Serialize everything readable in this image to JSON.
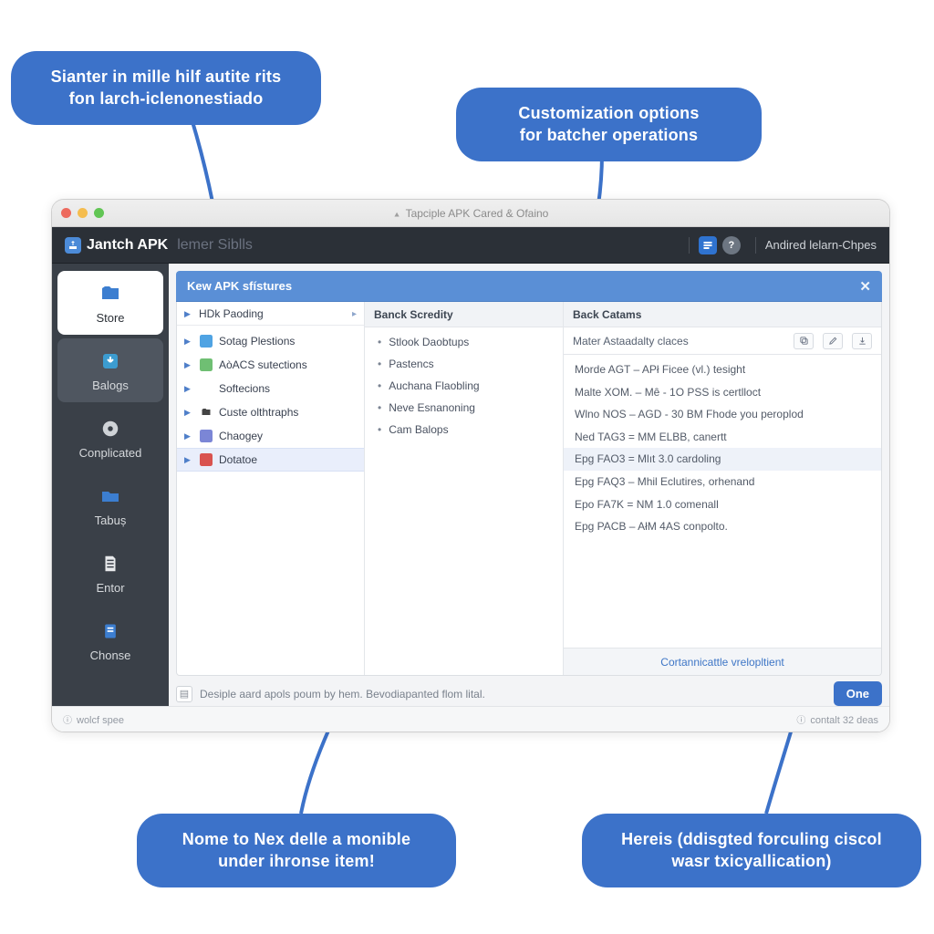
{
  "callouts": {
    "top_left": {
      "line1": "Sianter in mille hilf autite rits",
      "line2": "fon larch-iclenonestiado"
    },
    "top_right": {
      "line1": "Customization options",
      "line2": "for batcher operations"
    },
    "bottom_left": {
      "line1": "Nome to Nex delle a monible",
      "line2": "under ihronse item!"
    },
    "bottom_right": {
      "line1": "Hereis (ddisgted forculing ciscol",
      "line2": "wasr txicyallication)"
    }
  },
  "window": {
    "title": "Tapciple APK Cared & Ofaino"
  },
  "appbar": {
    "brand": "Jantch APK",
    "subtitle": "lemer Siblls",
    "user": "Andired lelarn-Chpes"
  },
  "sidebar": [
    {
      "id": "store",
      "label": "Store"
    },
    {
      "id": "balogs",
      "label": "Balogs"
    },
    {
      "id": "conplicated",
      "label": "Conplicated"
    },
    {
      "id": "tabus",
      "label": "Tabuș"
    },
    {
      "id": "entor",
      "label": "Entor"
    },
    {
      "id": "chonse",
      "label": "Chonse"
    }
  ],
  "panel": {
    "title": "Kew APK sfístures",
    "tree": [
      {
        "label": "HDk Paoding"
      },
      {
        "label": "Sotag Plestions"
      },
      {
        "label": "AòACS sutections"
      },
      {
        "label": "Softecions"
      },
      {
        "label": "Custe olthtraphs"
      },
      {
        "label": "Chaogey"
      },
      {
        "label": "Dotatoe"
      }
    ],
    "col_b": {
      "title": "Banck Scredity",
      "items": [
        "Stlook Daobtups",
        "Pastencs",
        "Auchana Flaobling",
        "Neve Esnanoning",
        "Cam Balops"
      ]
    },
    "col_c": {
      "title": "Back Catams",
      "toolbar_label": "Mater Astaadalty claces",
      "lines": [
        "Morde AGT – APł Ficee (vl.) tesight",
        "Malte XOM. – Mȇ - 1O PSS is certlloct",
        "Wlno NOS – AGD - 30 BM Fhode you peroplod",
        "Ned TAG3  =  MM  ELBB, canertt",
        "Epg FAO3 =  Mlıt  3.0  cardoling",
        "Epg FAQ3 –  Mhil  Eclutires, orhenand",
        "Epo FA7K  =  NM  1.0  comenall",
        "Epg PACB – AłM   4AS  conpolto."
      ],
      "footer_link": "Cortannicattle vrelopltient"
    }
  },
  "footer": {
    "text": "Desiple aard apols poum by hem. Bevodiapanted flom lital.",
    "button": "One"
  },
  "status": {
    "left": "wolcf spee",
    "right": "contalt 32 deas"
  }
}
